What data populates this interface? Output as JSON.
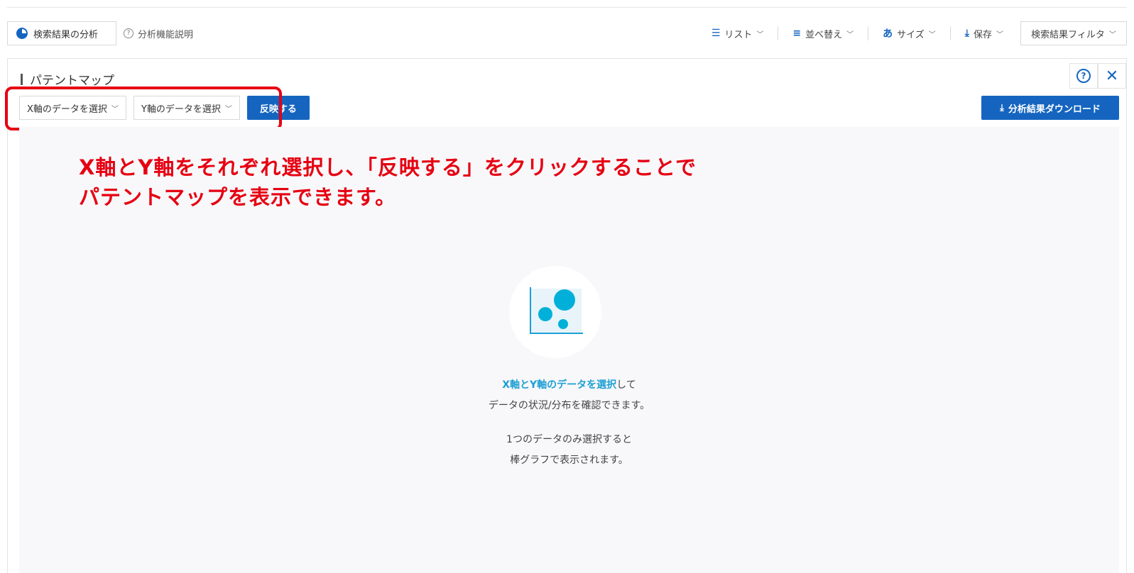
{
  "toolbar": {
    "analysis_label": "検索結果の分析",
    "help_label": "分析機能説明",
    "list_label": "リスト",
    "sort_label": "並べ替え",
    "size_label": "サイズ",
    "save_label": "保存",
    "filter_label": "検索結果フィルタ"
  },
  "panel": {
    "title": "パテントマップ",
    "x_select": "X軸のデータを選択",
    "y_select": "Y軸のデータを選択",
    "apply_label": "反映する",
    "download_label": "分析結果ダウンロード"
  },
  "annotation": {
    "line1": "X軸とY軸をそれぞれ選択し、「反映する」をクリックすることで",
    "line2": "パテントマップを表示できます。"
  },
  "empty_state": {
    "highlight": "X軸とY軸のデータを選択",
    "suffix": "して",
    "line2": "データの状況/分布を確認できます。",
    "line3": "1つのデータのみ選択すると",
    "line4": "棒グラフで表示されます。"
  },
  "colors": {
    "accent": "#1565c0",
    "annotation_red": "#e60012",
    "bubble": "#00b0d8"
  }
}
